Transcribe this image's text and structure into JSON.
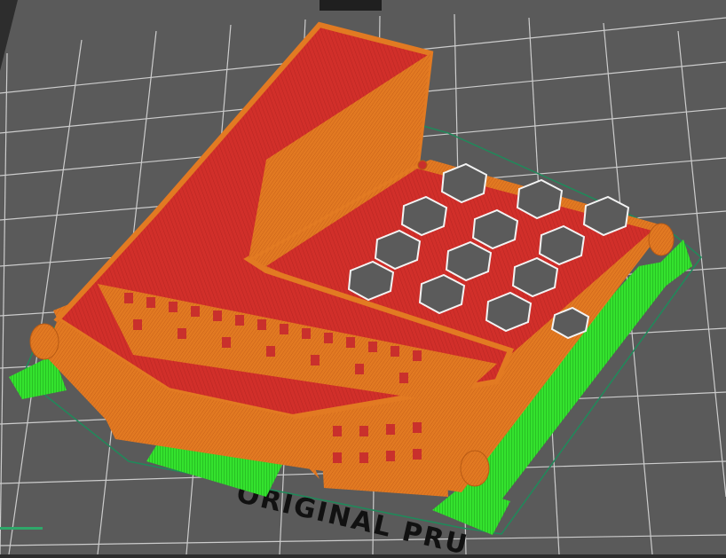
{
  "viewport": {
    "bed_label": "ORIGINAL PRU",
    "colors": {
      "background": "#2d2d2d",
      "bed": "#5b5b5b",
      "grid": "#d8d8d8",
      "top_solid": "#c9302c",
      "perimeter": "#e07420",
      "support": "#2fe02b",
      "skirt": "#1f8a5a"
    },
    "icons": [
      "print-bed",
      "sliced-model",
      "support-material",
      "skirt-outline"
    ]
  }
}
